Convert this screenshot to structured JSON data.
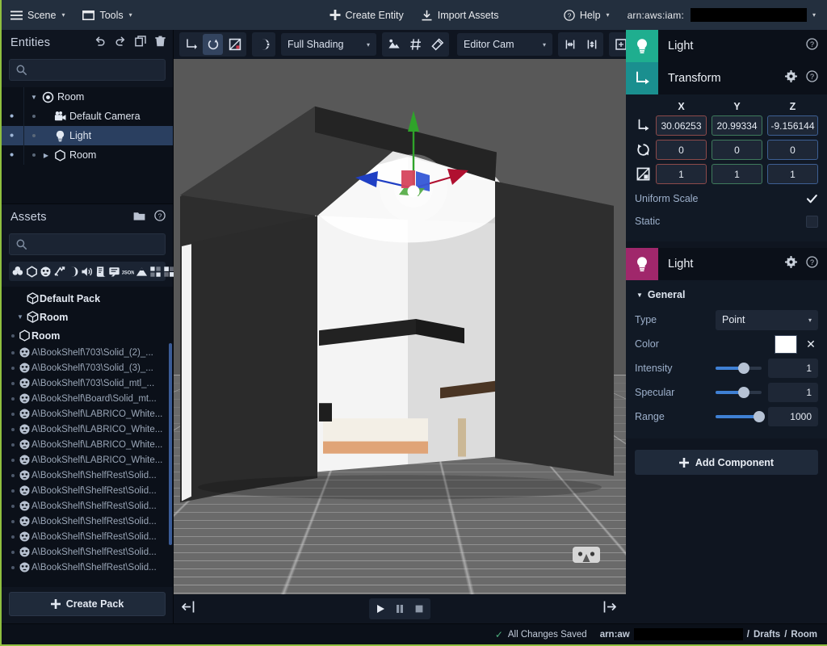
{
  "topbar": {
    "scene_menu": "Scene",
    "tools_menu": "Tools",
    "create_entity": "Create Entity",
    "import_assets": "Import Assets",
    "help": "Help",
    "arn_label": "arn:aws:iam:",
    "caret": "▾"
  },
  "entities_panel": {
    "title": "Entities",
    "search_placeholder": "",
    "search_value": "",
    "actions": [
      "undo-icon",
      "redo-icon",
      "duplicate-icon",
      "delete-icon"
    ],
    "tree": [
      {
        "label": "Room",
        "depth": 0,
        "icon": "scene-root-icon",
        "expander": "▼",
        "selected": false,
        "eye": false
      },
      {
        "label": "Default Camera",
        "depth": 1,
        "icon": "camera-icon",
        "expander": "",
        "selected": false,
        "eye": true
      },
      {
        "label": "Light",
        "depth": 1,
        "icon": "light-bulb-icon",
        "expander": "",
        "selected": true,
        "eye": true
      },
      {
        "label": "Room",
        "depth": 1,
        "icon": "mesh-icon",
        "expander": "▶",
        "selected": false,
        "eye": true
      }
    ]
  },
  "assets_panel": {
    "title": "Assets",
    "search_placeholder": "",
    "search_value": "",
    "filter_icons": [
      "material-icon",
      "shape-icon",
      "model-icon",
      "animation-icon",
      "texture-icon",
      "audio-icon",
      "script-icon",
      "shader-icon",
      "json-icon",
      "terrain-icon",
      "sprite-icon",
      "tilemap-icon"
    ],
    "create_pack": "Create Pack",
    "items": [
      {
        "label": "Default Pack",
        "kind": "pack",
        "depth": 0,
        "expander": "",
        "icon": "package-icon"
      },
      {
        "label": "Room",
        "kind": "pack",
        "depth": 0,
        "expander": "▼",
        "icon": "package-icon"
      },
      {
        "label": "Room",
        "kind": "entity",
        "depth": 1,
        "expander": "",
        "icon": "mesh-icon"
      },
      {
        "label": "A\\BookShelf\\703\\Solid_(2)_...",
        "kind": "model",
        "depth": 1,
        "expander": "",
        "icon": "model-icon"
      },
      {
        "label": "A\\BookShelf\\703\\Solid_(3)_...",
        "kind": "model",
        "depth": 1,
        "expander": "",
        "icon": "model-icon"
      },
      {
        "label": "A\\BookShelf\\703\\Solid_mtl_...",
        "kind": "model",
        "depth": 1,
        "expander": "",
        "icon": "model-icon"
      },
      {
        "label": "A\\BookShelf\\Board\\Solid_mt...",
        "kind": "model",
        "depth": 1,
        "expander": "",
        "icon": "model-icon"
      },
      {
        "label": "A\\BookShelf\\LABRICO_White...",
        "kind": "model",
        "depth": 1,
        "expander": "",
        "icon": "model-icon"
      },
      {
        "label": "A\\BookShelf\\LABRICO_White...",
        "kind": "model",
        "depth": 1,
        "expander": "",
        "icon": "model-icon"
      },
      {
        "label": "A\\BookShelf\\LABRICO_White...",
        "kind": "model",
        "depth": 1,
        "expander": "",
        "icon": "model-icon"
      },
      {
        "label": "A\\BookShelf\\LABRICO_White...",
        "kind": "model",
        "depth": 1,
        "expander": "",
        "icon": "model-icon"
      },
      {
        "label": "A\\BookShelf\\ShelfRest\\Solid...",
        "kind": "model",
        "depth": 1,
        "expander": "",
        "icon": "model-icon"
      },
      {
        "label": "A\\BookShelf\\ShelfRest\\Solid...",
        "kind": "model",
        "depth": 1,
        "expander": "",
        "icon": "model-icon"
      },
      {
        "label": "A\\BookShelf\\ShelfRest\\Solid...",
        "kind": "model",
        "depth": 1,
        "expander": "",
        "icon": "model-icon"
      },
      {
        "label": "A\\BookShelf\\ShelfRest\\Solid...",
        "kind": "model",
        "depth": 1,
        "expander": "",
        "icon": "model-icon"
      },
      {
        "label": "A\\BookShelf\\ShelfRest\\Solid...",
        "kind": "model",
        "depth": 1,
        "expander": "",
        "icon": "model-icon"
      },
      {
        "label": "A\\BookShelf\\ShelfRest\\Solid...",
        "kind": "model",
        "depth": 1,
        "expander": "",
        "icon": "model-icon"
      },
      {
        "label": "A\\BookShelf\\ShelfRest\\Solid...",
        "kind": "model",
        "depth": 1,
        "expander": "",
        "icon": "model-icon"
      }
    ]
  },
  "viewport_toolbar": {
    "transform_modes": [
      {
        "name": "translate-tool",
        "active": false
      },
      {
        "name": "rotate-tool",
        "active": true
      },
      {
        "name": "scale-tool",
        "active": false
      }
    ],
    "world_local": "world-space-icon",
    "shading_mode": "Full Shading",
    "shading_caret": "▾",
    "toggles": [
      "lighting-toggle-icon",
      "grid-toggle-icon",
      "effects-toggle-icon"
    ],
    "camera": "Editor Cam",
    "camera_caret": "▾",
    "snap_buttons": [
      "focus-horizontal-icon",
      "focus-vertical-icon",
      "fit-view-icon"
    ]
  },
  "viewport": {
    "vr_badge": "vr-headset-icon",
    "expand_left": "expand-left-icon",
    "expand_right": "expand-right-icon",
    "play": "play-icon",
    "pause": "pause-icon",
    "stop": "stop-icon"
  },
  "inspector": {
    "entity": {
      "name": "Light",
      "icon": "light-bulb-icon",
      "help": "help-icon"
    },
    "transform": {
      "title": "Transform",
      "icon": "transform-axis-icon",
      "settings": "gear-icon",
      "help": "help-icon",
      "axes": [
        "X",
        "Y",
        "Z"
      ],
      "rows": [
        {
          "icon": "position-icon",
          "values": [
            "30.06253",
            "20.99334",
            "-9.156144"
          ]
        },
        {
          "icon": "rotation-icon",
          "values": [
            "0",
            "0",
            "0"
          ]
        },
        {
          "icon": "scale-icon",
          "values": [
            "1",
            "1",
            "1"
          ]
        }
      ],
      "uniform_scale_label": "Uniform Scale",
      "uniform_scale_checked": true,
      "static_label": "Static",
      "static_checked": false
    },
    "light": {
      "title": "Light",
      "icon": "light-bulb-icon",
      "settings": "gear-icon",
      "help": "help-icon",
      "section": "General",
      "section_caret": "▼",
      "type_label": "Type",
      "type_value": "Point",
      "type_caret": "▾",
      "color_label": "Color",
      "color_value": "#ffffff",
      "color_clear": "✕",
      "sliders": [
        {
          "label": "Intensity",
          "value": "1",
          "percent": 62
        },
        {
          "label": "Specular",
          "value": "1",
          "percent": 62
        },
        {
          "label": "Range",
          "value": "1000",
          "percent": 94
        }
      ]
    },
    "add_component": "Add Component"
  },
  "statusbar": {
    "saved_text": "All Changes Saved",
    "saved_check": "✓",
    "arn_prefix": "arn:aw",
    "breadcrumb": [
      "Drafts",
      "Room"
    ],
    "separator": "/"
  },
  "colors": {
    "accent_green": "#8fbf3f",
    "header_bg": "#232f3e",
    "panel_bg": "#0f1520",
    "selection_blue": "#2a3f60",
    "light_teal": "#1fae8f",
    "transform_teal": "#1a8f8f",
    "light_magenta": "#a0276b",
    "axis_x_red": "#c9374a",
    "axis_y_green": "#3fae2a",
    "axis_z_blue": "#2a5fd4",
    "slider_blue": "#3f80d4",
    "saved_green": "#4caf7d"
  }
}
